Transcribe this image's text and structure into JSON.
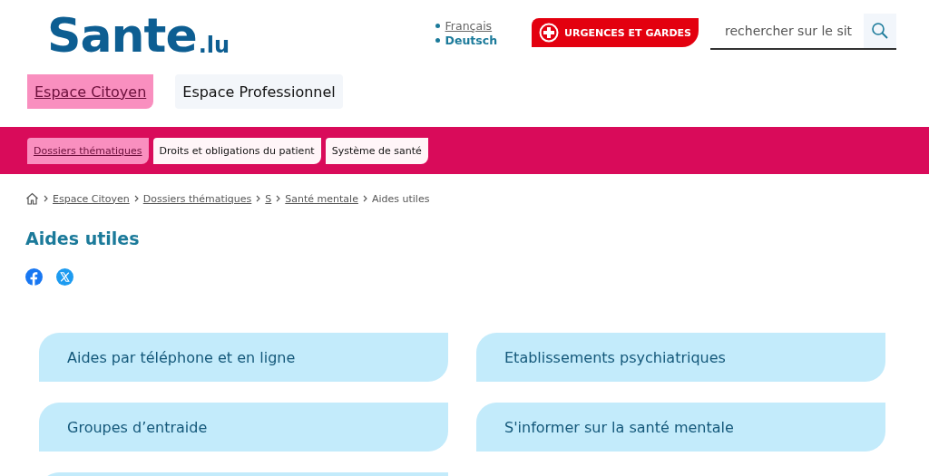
{
  "logo": {
    "name": "Sante",
    "suffix": ".lu"
  },
  "languages": [
    {
      "label": "Français",
      "selected": true
    },
    {
      "label": "Deutsch",
      "selected": false
    }
  ],
  "emergency_button": {
    "label": "URGENCES ET GARDES"
  },
  "search": {
    "placeholder": "rechercher sur le sit"
  },
  "spaces": [
    {
      "label": "Espace Citoyen",
      "selected": true
    },
    {
      "label": "Espace Professionnel",
      "selected": false
    }
  ],
  "subnav": [
    {
      "label": "Dossiers thématiques",
      "selected": true
    },
    {
      "label": "Droits et obligations du patient",
      "selected": false
    },
    {
      "label": "Système de santé",
      "selected": false
    }
  ],
  "breadcrumb": [
    {
      "label": "Espace Citoyen",
      "kind": "link"
    },
    {
      "label": "Dossiers thématiques",
      "kind": "link"
    },
    {
      "label": "S",
      "kind": "link"
    },
    {
      "label": "Santé mentale",
      "kind": "link"
    },
    {
      "label": "Aides utiles",
      "kind": "current"
    }
  ],
  "title": "Aides utiles",
  "share": [
    {
      "kind": "facebook"
    },
    {
      "kind": "x"
    }
  ],
  "cards": [
    {
      "kind": "full",
      "label": "Aides par téléphone et en ligne"
    },
    {
      "kind": "full",
      "label": "Etablissements psychiatriques"
    },
    {
      "kind": "full",
      "label": "Groupes d’entraide"
    },
    {
      "kind": "full",
      "label": "S'informer sur la santé mentale"
    },
    {
      "kind": "partial"
    }
  ]
}
